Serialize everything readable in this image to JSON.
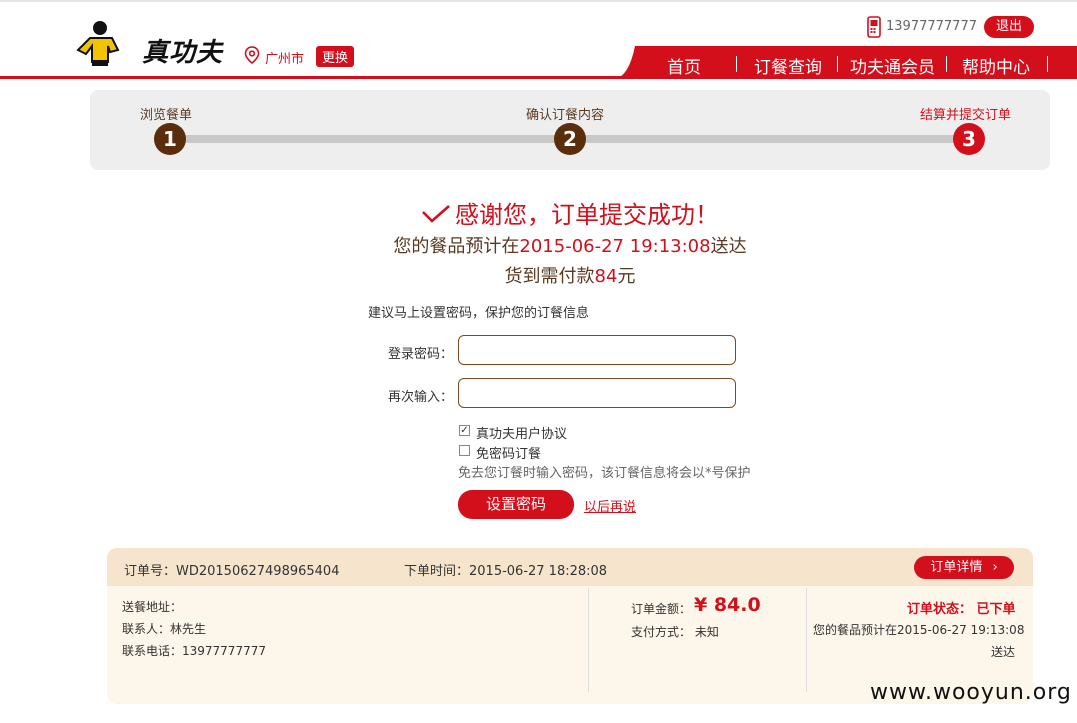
{
  "header": {
    "logo_text": "真功夫",
    "city": "广州市",
    "change_label": "更换",
    "phone": "13977777777",
    "logout_label": "退出",
    "nav": [
      "首页",
      "订餐查询",
      "功夫通会员",
      "帮助中心"
    ]
  },
  "steps": [
    {
      "label": "浏览餐单",
      "num": "1"
    },
    {
      "label": "确认订餐内容",
      "num": "2"
    },
    {
      "label": "结算并提交订单",
      "num": "3"
    }
  ],
  "success": {
    "title": "感谢您，订单提交成功！",
    "eta_prefix": "您的餐品预计在",
    "eta_time": "2015-06-27 19:13:08",
    "eta_suffix": "送达",
    "pay_prefix": "货到需付款",
    "pay_amount": "84",
    "pay_unit": "元"
  },
  "password_form": {
    "hint": "建议马上设置密码，保护您的订餐信息",
    "password_label": "登录密码：",
    "password_value": "",
    "confirm_label": "再次输入：",
    "confirm_value": "",
    "agreement_label": "真功夫用户协议",
    "agreement_checked": true,
    "nopass_label": "免密码订餐",
    "nopass_checked": false,
    "note": "免去您订餐时输入密码，该订餐信息将会以*号保护",
    "submit_label": "设置密码",
    "later_label": "以后再说"
  },
  "order": {
    "id_text": "订单号：WD20150627498965404",
    "time_text": "下单时间：2015-06-27 18:28:08",
    "detail_label": "订单详情",
    "address_text": "送餐地址：",
    "contact_text": "联系人：林先生",
    "phone_text": "联系电话：13977777777",
    "amount_label": "订单金额：",
    "amount_value": "¥ 84.0",
    "payment_text": "支付方式：  未知",
    "status_text": "订单状态：  已下单",
    "eta_line1": "您的餐品预计在2015-06-27 19:13:08",
    "eta_line2": "送达"
  },
  "watermark": "www.wooyun.org",
  "colors": {
    "brand_red": "#d40f1c",
    "brown": "#5a2d0c"
  }
}
